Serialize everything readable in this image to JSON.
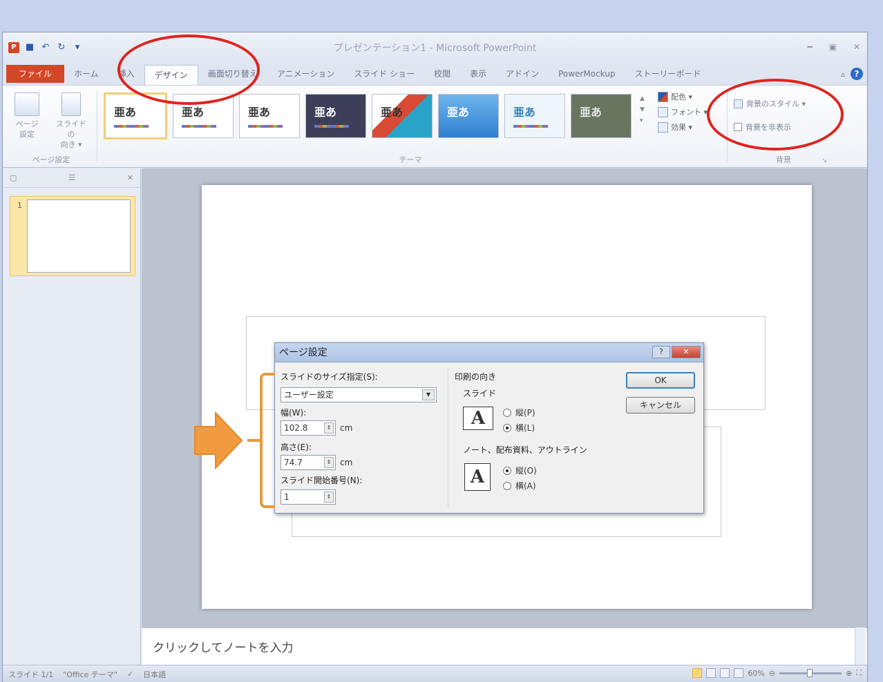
{
  "app": {
    "window_title": "プレゼンテーション1 - Microsoft PowerPoint",
    "window_buttons": [
      "━",
      "▣",
      "✕"
    ]
  },
  "tabs": [
    {
      "label": "ファイル"
    },
    {
      "label": "ホーム"
    },
    {
      "label": "挿入"
    },
    {
      "label": "デザイン"
    },
    {
      "label": "画面切り替え"
    },
    {
      "label": "アニメーション"
    },
    {
      "label": "スライド ショー"
    },
    {
      "label": "校閲"
    },
    {
      "label": "表示"
    },
    {
      "label": "アドイン"
    },
    {
      "label": "PowerMockup"
    },
    {
      "label": "ストーリーボード"
    }
  ],
  "ribbon": {
    "page_setup": {
      "label1": "ページ",
      "label1b": "設定",
      "label2": "スライドの",
      "label2b": "向き ▾",
      "group": "ページ設定"
    },
    "themes": [
      {
        "text": "亜あ",
        "bg": "#ffffff",
        "fg": "#333333",
        "selected": true
      },
      {
        "text": "亜あ",
        "bg": "#ffffff",
        "fg": "#333333"
      },
      {
        "text": "亜あ",
        "bg": "#ffffff",
        "fg": "#333333"
      },
      {
        "text": "亜あ",
        "bg": "#3d3f5a",
        "fg": "#ffffff"
      },
      {
        "text": "亜あ",
        "bg": "#29a3c8",
        "fg": "#222222"
      },
      {
        "text": "亜あ",
        "bg": "#4e9be0",
        "fg": "#ffffff"
      },
      {
        "text": "亜あ",
        "bg": "#eef6fb",
        "fg": "#2f7fb8"
      },
      {
        "text": "亜あ",
        "bg": "#6a7560",
        "fg": "#e8e8e8"
      }
    ],
    "theme_group": "テーマ",
    "colors": "配色 ▾",
    "fonts": "フォント ▾",
    "effects": "効果 ▾",
    "bg_styles": "背景のスタイル ▾",
    "hide_bg": "背景を非表示",
    "bg_group": "背景"
  },
  "slides_pane": {
    "thumb_number": "1"
  },
  "dialog": {
    "title": "ページ設定",
    "size_label": "スライドのサイズ指定(S):",
    "size_value": "ユーザー設定",
    "width_label": "幅(W):",
    "width_value": "102.8",
    "height_label": "高さ(E):",
    "height_value": "74.7",
    "unit": "cm",
    "start_label": "スライド開始番号(N):",
    "start_value": "1",
    "orientation_label": "印刷の向き",
    "slide_label": "スライド",
    "portrait_slide": "縦(P)",
    "landscape_slide": "横(L)",
    "notes_label": "ノート、配布資料、アウトライン",
    "portrait_notes": "縦(O)",
    "landscape_notes": "横(A)",
    "ok": "OK",
    "cancel": "キャンセル"
  },
  "notes": {
    "placeholder": "クリックしてノートを入力"
  },
  "status": {
    "slide": "スライド 1/1",
    "theme": "\"Office テーマ\"",
    "language": "日本語",
    "zoom": "60%"
  },
  "colors": {
    "file_tab": "#d24726",
    "highlight": "#e0231e",
    "arrow": "#e59a3b"
  }
}
